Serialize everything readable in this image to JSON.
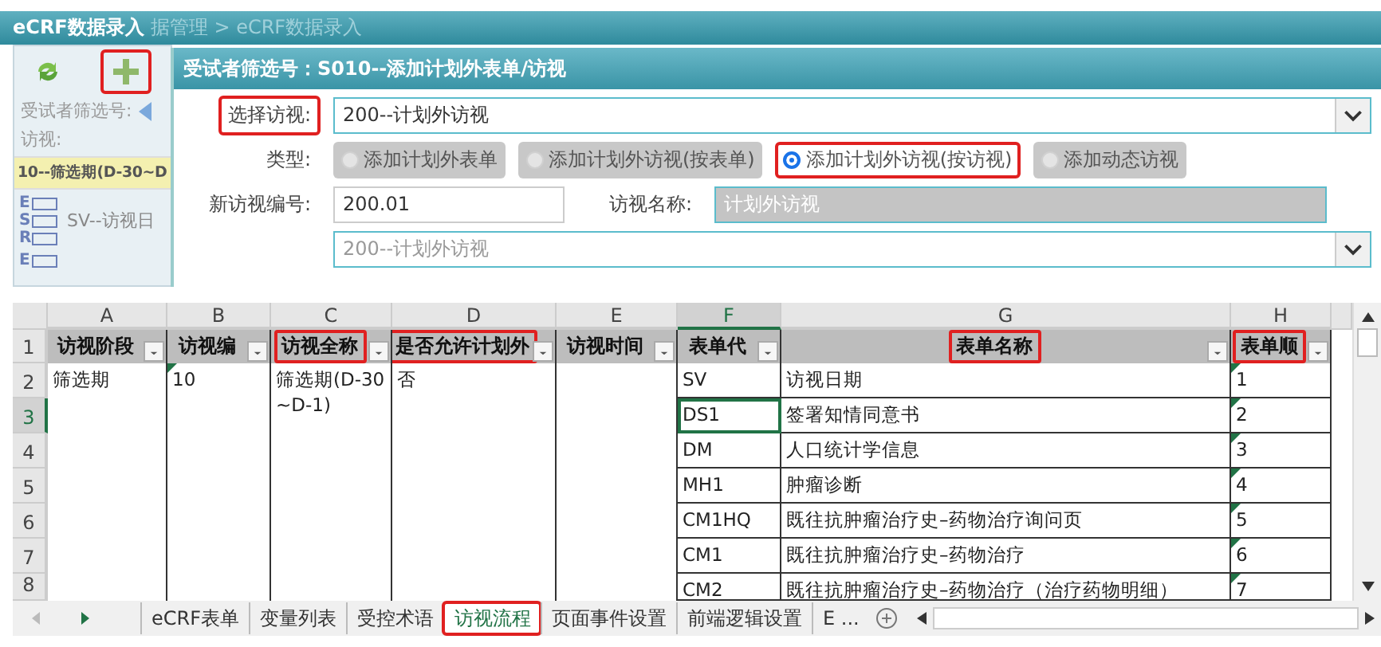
{
  "app": {
    "title": "eCRF数据录入",
    "breadcrumb": "据管理 > eCRF数据录入",
    "sidebar": {
      "add_highlighted": true,
      "subject_label": "受试者筛选号:",
      "visit_label": "访视:",
      "visit_item": "10--筛选期(D-30~D",
      "form_item": "SV--访视日",
      "status_letters": [
        "E",
        "S",
        "R"
      ],
      "status_letters_2": [
        "E"
      ]
    },
    "dialog": {
      "title": "受试者筛选号：S010--添加计划外表单/访视",
      "visit_label": "选择访视:",
      "visit_label_highlighted": true,
      "visit_value": "200--计划外访视",
      "type_label": "类型:",
      "types": [
        {
          "label": "添加计划外表单",
          "selected": false,
          "highlighted": false
        },
        {
          "label": "添加计划外访视(按表单)",
          "selected": false,
          "highlighted": false
        },
        {
          "label": "添加计划外访视(按访视)",
          "selected": true,
          "highlighted": true
        },
        {
          "label": "添加动态访视",
          "selected": false,
          "highlighted": false
        }
      ],
      "number_label": "新访视编号:",
      "number_value": "200.01",
      "name_label": "访视名称:",
      "name_value": "计划外访视",
      "second_select_placeholder": "200--计划外访视"
    }
  },
  "sheet": {
    "columns": [
      {
        "letter": "A",
        "header": "访视阶段",
        "selected": false,
        "highlighted": false
      },
      {
        "letter": "B",
        "header": "访视编",
        "selected": false,
        "highlighted": false
      },
      {
        "letter": "C",
        "header": "访视全称",
        "selected": false,
        "highlighted": true
      },
      {
        "letter": "D",
        "header": "是否允许计划外",
        "selected": false,
        "highlighted": true
      },
      {
        "letter": "E",
        "header": "访视时间",
        "selected": false,
        "highlighted": false
      },
      {
        "letter": "F",
        "header": "表单代",
        "selected": true,
        "highlighted": false
      },
      {
        "letter": "G",
        "header": "表单名称",
        "selected": false,
        "highlighted": true
      },
      {
        "letter": "H",
        "header": "表单顺",
        "selected": false,
        "highlighted": true
      }
    ],
    "header_row_number": "1",
    "visit": {
      "stage": "筛选期",
      "number": "10",
      "number_warning": true,
      "full_name": "筛选期(D-30~D-1)",
      "allow_unplanned": "否"
    },
    "rows": [
      {
        "row_number": "2",
        "code": "SV",
        "name": "访视日期",
        "order": "1",
        "warning": true,
        "selected": false
      },
      {
        "row_number": "3",
        "code": "DS1",
        "name": "签署知情同意书",
        "order": "2",
        "warning": true,
        "selected": true
      },
      {
        "row_number": "4",
        "code": "DM",
        "name": "人口统计学信息",
        "order": "3",
        "warning": true,
        "selected": false
      },
      {
        "row_number": "5",
        "code": "MH1",
        "name": "肿瘤诊断",
        "order": "4",
        "warning": true,
        "selected": false
      },
      {
        "row_number": "6",
        "code": "CM1HQ",
        "name": "既往抗肿瘤治疗史–药物治疗询问页",
        "order": "5",
        "warning": true,
        "selected": false
      },
      {
        "row_number": "7",
        "code": "CM1",
        "name": "既往抗肿瘤治疗史–药物治疗",
        "order": "6",
        "warning": true,
        "selected": false
      },
      {
        "row_number": "8",
        "code": "CM2",
        "name": "既往抗肿瘤治疗史–药物治疗（治疗药物明细）",
        "order": "7",
        "warning": true,
        "selected": false
      }
    ],
    "tabs": [
      {
        "label": "eCRF表单",
        "selected": false,
        "highlighted": false
      },
      {
        "label": "变量列表",
        "selected": false,
        "highlighted": false
      },
      {
        "label": "受控术语",
        "selected": false,
        "highlighted": false
      },
      {
        "label": "访视流程",
        "selected": true,
        "highlighted": true
      },
      {
        "label": "页面事件设置",
        "selected": false,
        "highlighted": false
      },
      {
        "label": "前端逻辑设置",
        "selected": false,
        "highlighted": false
      },
      {
        "label": "E ...",
        "selected": false,
        "highlighted": false
      }
    ]
  }
}
